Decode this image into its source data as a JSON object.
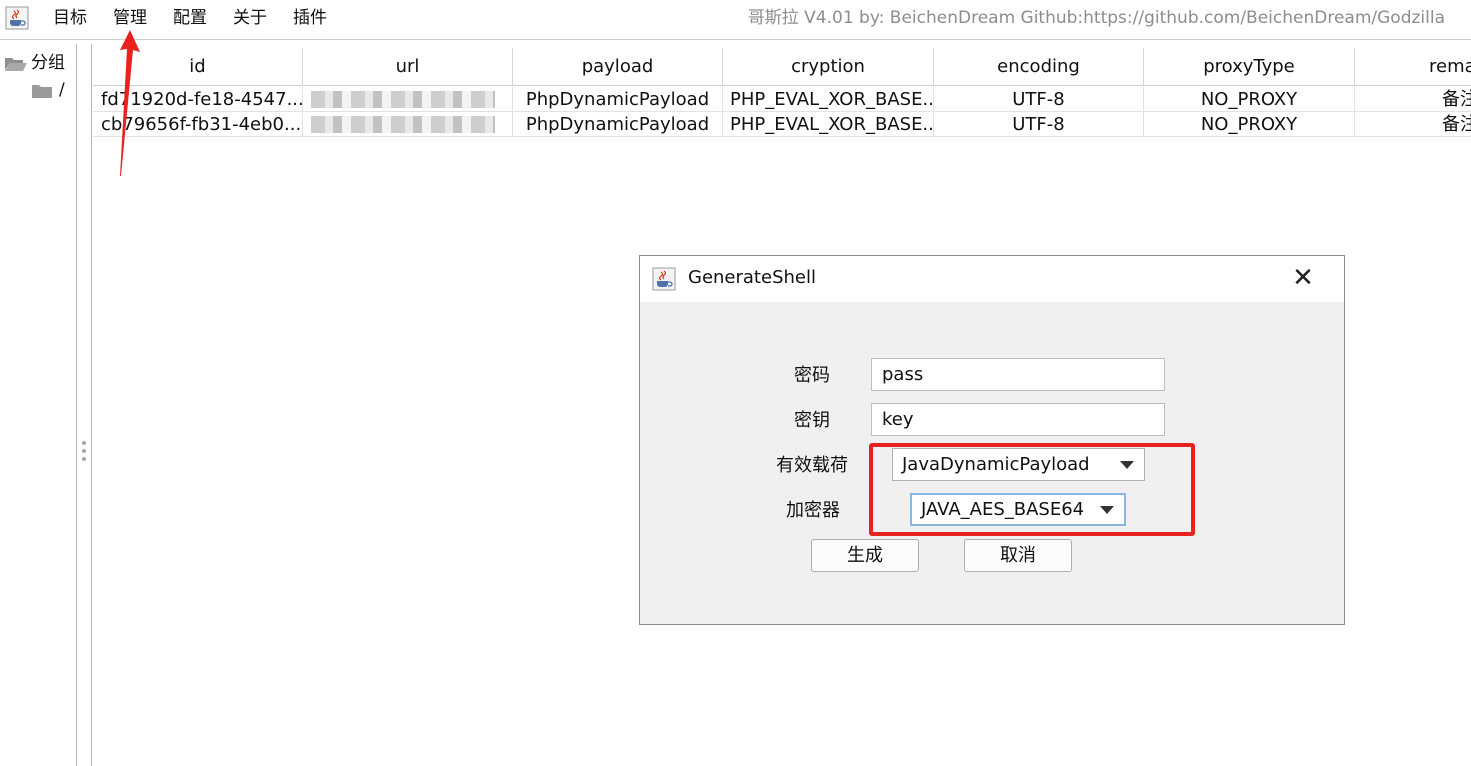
{
  "menubar": {
    "items": [
      "目标",
      "管理",
      "配置",
      "关于",
      "插件"
    ],
    "window_title": "哥斯拉 V4.01 by: BeichenDream Github:https://github.com/BeichenDream/Godzilla"
  },
  "tree": {
    "root_label": "分组",
    "child_label": "/"
  },
  "table": {
    "columns": [
      "id",
      "url",
      "payload",
      "cryption",
      "encoding",
      "proxyType",
      "rema"
    ],
    "rows": [
      {
        "id": "fd71920d-fe18-4547...",
        "url": "",
        "payload": "PhpDynamicPayload",
        "cryption": "PHP_EVAL_XOR_BASE...",
        "encoding": "UTF-8",
        "proxyType": "NO_PROXY",
        "remark": "备注"
      },
      {
        "id": "cb79656f-fb31-4eb0...",
        "url": "",
        "payload": "PhpDynamicPayload",
        "cryption": "PHP_EVAL_XOR_BASE...",
        "encoding": "UTF-8",
        "proxyType": "NO_PROXY",
        "remark": "备注"
      }
    ]
  },
  "dialog": {
    "title": "GenerateShell",
    "close_glyph": "✕",
    "password_label": "密码",
    "password_value": "pass",
    "key_label": "密钥",
    "key_value": "key",
    "payload_label": "有效载荷",
    "payload_value": "JavaDynamicPayload",
    "cryption_label": "加密器",
    "cryption_value": "JAVA_AES_BASE64",
    "generate_label": "生成",
    "cancel_label": "取消"
  },
  "colors": {
    "annotation": "#e8221e",
    "focus_border": "#8ab6e6"
  }
}
